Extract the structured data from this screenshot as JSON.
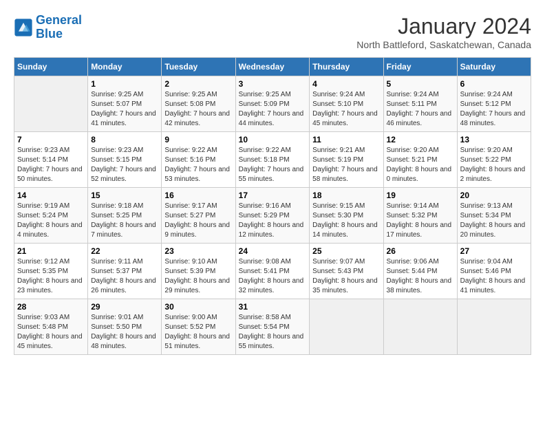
{
  "header": {
    "logo_line1": "General",
    "logo_line2": "Blue",
    "month": "January 2024",
    "location": "North Battleford, Saskatchewan, Canada"
  },
  "weekdays": [
    "Sunday",
    "Monday",
    "Tuesday",
    "Wednesday",
    "Thursday",
    "Friday",
    "Saturday"
  ],
  "weeks": [
    [
      {
        "day": "",
        "sunrise": "",
        "sunset": "",
        "daylight": ""
      },
      {
        "day": "1",
        "sunrise": "Sunrise: 9:25 AM",
        "sunset": "Sunset: 5:07 PM",
        "daylight": "Daylight: 7 hours and 41 minutes."
      },
      {
        "day": "2",
        "sunrise": "Sunrise: 9:25 AM",
        "sunset": "Sunset: 5:08 PM",
        "daylight": "Daylight: 7 hours and 42 minutes."
      },
      {
        "day": "3",
        "sunrise": "Sunrise: 9:25 AM",
        "sunset": "Sunset: 5:09 PM",
        "daylight": "Daylight: 7 hours and 44 minutes."
      },
      {
        "day": "4",
        "sunrise": "Sunrise: 9:24 AM",
        "sunset": "Sunset: 5:10 PM",
        "daylight": "Daylight: 7 hours and 45 minutes."
      },
      {
        "day": "5",
        "sunrise": "Sunrise: 9:24 AM",
        "sunset": "Sunset: 5:11 PM",
        "daylight": "Daylight: 7 hours and 46 minutes."
      },
      {
        "day": "6",
        "sunrise": "Sunrise: 9:24 AM",
        "sunset": "Sunset: 5:12 PM",
        "daylight": "Daylight: 7 hours and 48 minutes."
      }
    ],
    [
      {
        "day": "7",
        "sunrise": "Sunrise: 9:23 AM",
        "sunset": "Sunset: 5:14 PM",
        "daylight": "Daylight: 7 hours and 50 minutes."
      },
      {
        "day": "8",
        "sunrise": "Sunrise: 9:23 AM",
        "sunset": "Sunset: 5:15 PM",
        "daylight": "Daylight: 7 hours and 52 minutes."
      },
      {
        "day": "9",
        "sunrise": "Sunrise: 9:22 AM",
        "sunset": "Sunset: 5:16 PM",
        "daylight": "Daylight: 7 hours and 53 minutes."
      },
      {
        "day": "10",
        "sunrise": "Sunrise: 9:22 AM",
        "sunset": "Sunset: 5:18 PM",
        "daylight": "Daylight: 7 hours and 55 minutes."
      },
      {
        "day": "11",
        "sunrise": "Sunrise: 9:21 AM",
        "sunset": "Sunset: 5:19 PM",
        "daylight": "Daylight: 7 hours and 58 minutes."
      },
      {
        "day": "12",
        "sunrise": "Sunrise: 9:20 AM",
        "sunset": "Sunset: 5:21 PM",
        "daylight": "Daylight: 8 hours and 0 minutes."
      },
      {
        "day": "13",
        "sunrise": "Sunrise: 9:20 AM",
        "sunset": "Sunset: 5:22 PM",
        "daylight": "Daylight: 8 hours and 2 minutes."
      }
    ],
    [
      {
        "day": "14",
        "sunrise": "Sunrise: 9:19 AM",
        "sunset": "Sunset: 5:24 PM",
        "daylight": "Daylight: 8 hours and 4 minutes."
      },
      {
        "day": "15",
        "sunrise": "Sunrise: 9:18 AM",
        "sunset": "Sunset: 5:25 PM",
        "daylight": "Daylight: 8 hours and 7 minutes."
      },
      {
        "day": "16",
        "sunrise": "Sunrise: 9:17 AM",
        "sunset": "Sunset: 5:27 PM",
        "daylight": "Daylight: 8 hours and 9 minutes."
      },
      {
        "day": "17",
        "sunrise": "Sunrise: 9:16 AM",
        "sunset": "Sunset: 5:29 PM",
        "daylight": "Daylight: 8 hours and 12 minutes."
      },
      {
        "day": "18",
        "sunrise": "Sunrise: 9:15 AM",
        "sunset": "Sunset: 5:30 PM",
        "daylight": "Daylight: 8 hours and 14 minutes."
      },
      {
        "day": "19",
        "sunrise": "Sunrise: 9:14 AM",
        "sunset": "Sunset: 5:32 PM",
        "daylight": "Daylight: 8 hours and 17 minutes."
      },
      {
        "day": "20",
        "sunrise": "Sunrise: 9:13 AM",
        "sunset": "Sunset: 5:34 PM",
        "daylight": "Daylight: 8 hours and 20 minutes."
      }
    ],
    [
      {
        "day": "21",
        "sunrise": "Sunrise: 9:12 AM",
        "sunset": "Sunset: 5:35 PM",
        "daylight": "Daylight: 8 hours and 23 minutes."
      },
      {
        "day": "22",
        "sunrise": "Sunrise: 9:11 AM",
        "sunset": "Sunset: 5:37 PM",
        "daylight": "Daylight: 8 hours and 26 minutes."
      },
      {
        "day": "23",
        "sunrise": "Sunrise: 9:10 AM",
        "sunset": "Sunset: 5:39 PM",
        "daylight": "Daylight: 8 hours and 29 minutes."
      },
      {
        "day": "24",
        "sunrise": "Sunrise: 9:08 AM",
        "sunset": "Sunset: 5:41 PM",
        "daylight": "Daylight: 8 hours and 32 minutes."
      },
      {
        "day": "25",
        "sunrise": "Sunrise: 9:07 AM",
        "sunset": "Sunset: 5:43 PM",
        "daylight": "Daylight: 8 hours and 35 minutes."
      },
      {
        "day": "26",
        "sunrise": "Sunrise: 9:06 AM",
        "sunset": "Sunset: 5:44 PM",
        "daylight": "Daylight: 8 hours and 38 minutes."
      },
      {
        "day": "27",
        "sunrise": "Sunrise: 9:04 AM",
        "sunset": "Sunset: 5:46 PM",
        "daylight": "Daylight: 8 hours and 41 minutes."
      }
    ],
    [
      {
        "day": "28",
        "sunrise": "Sunrise: 9:03 AM",
        "sunset": "Sunset: 5:48 PM",
        "daylight": "Daylight: 8 hours and 45 minutes."
      },
      {
        "day": "29",
        "sunrise": "Sunrise: 9:01 AM",
        "sunset": "Sunset: 5:50 PM",
        "daylight": "Daylight: 8 hours and 48 minutes."
      },
      {
        "day": "30",
        "sunrise": "Sunrise: 9:00 AM",
        "sunset": "Sunset: 5:52 PM",
        "daylight": "Daylight: 8 hours and 51 minutes."
      },
      {
        "day": "31",
        "sunrise": "Sunrise: 8:58 AM",
        "sunset": "Sunset: 5:54 PM",
        "daylight": "Daylight: 8 hours and 55 minutes."
      },
      {
        "day": "",
        "sunrise": "",
        "sunset": "",
        "daylight": ""
      },
      {
        "day": "",
        "sunrise": "",
        "sunset": "",
        "daylight": ""
      },
      {
        "day": "",
        "sunrise": "",
        "sunset": "",
        "daylight": ""
      }
    ]
  ]
}
